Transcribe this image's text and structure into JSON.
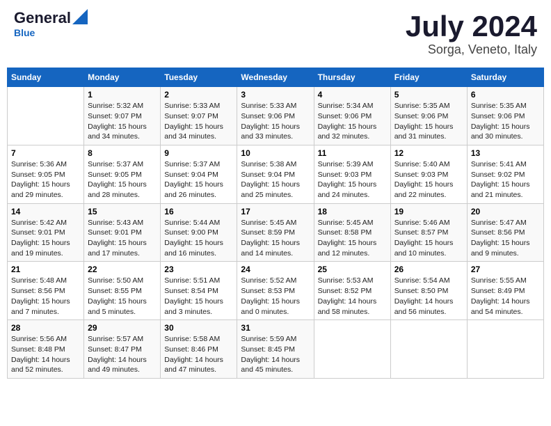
{
  "header": {
    "logo_line1": "General",
    "logo_line2": "Blue",
    "title": "July 2024",
    "subtitle": "Sorga, Veneto, Italy"
  },
  "weekdays": [
    "Sunday",
    "Monday",
    "Tuesday",
    "Wednesday",
    "Thursday",
    "Friday",
    "Saturday"
  ],
  "weeks": [
    [
      {
        "day": "",
        "info": ""
      },
      {
        "day": "1",
        "info": "Sunrise: 5:32 AM\nSunset: 9:07 PM\nDaylight: 15 hours\nand 34 minutes."
      },
      {
        "day": "2",
        "info": "Sunrise: 5:33 AM\nSunset: 9:07 PM\nDaylight: 15 hours\nand 34 minutes."
      },
      {
        "day": "3",
        "info": "Sunrise: 5:33 AM\nSunset: 9:06 PM\nDaylight: 15 hours\nand 33 minutes."
      },
      {
        "day": "4",
        "info": "Sunrise: 5:34 AM\nSunset: 9:06 PM\nDaylight: 15 hours\nand 32 minutes."
      },
      {
        "day": "5",
        "info": "Sunrise: 5:35 AM\nSunset: 9:06 PM\nDaylight: 15 hours\nand 31 minutes."
      },
      {
        "day": "6",
        "info": "Sunrise: 5:35 AM\nSunset: 9:06 PM\nDaylight: 15 hours\nand 30 minutes."
      }
    ],
    [
      {
        "day": "7",
        "info": "Sunrise: 5:36 AM\nSunset: 9:05 PM\nDaylight: 15 hours\nand 29 minutes."
      },
      {
        "day": "8",
        "info": "Sunrise: 5:37 AM\nSunset: 9:05 PM\nDaylight: 15 hours\nand 28 minutes."
      },
      {
        "day": "9",
        "info": "Sunrise: 5:37 AM\nSunset: 9:04 PM\nDaylight: 15 hours\nand 26 minutes."
      },
      {
        "day": "10",
        "info": "Sunrise: 5:38 AM\nSunset: 9:04 PM\nDaylight: 15 hours\nand 25 minutes."
      },
      {
        "day": "11",
        "info": "Sunrise: 5:39 AM\nSunset: 9:03 PM\nDaylight: 15 hours\nand 24 minutes."
      },
      {
        "day": "12",
        "info": "Sunrise: 5:40 AM\nSunset: 9:03 PM\nDaylight: 15 hours\nand 22 minutes."
      },
      {
        "day": "13",
        "info": "Sunrise: 5:41 AM\nSunset: 9:02 PM\nDaylight: 15 hours\nand 21 minutes."
      }
    ],
    [
      {
        "day": "14",
        "info": "Sunrise: 5:42 AM\nSunset: 9:01 PM\nDaylight: 15 hours\nand 19 minutes."
      },
      {
        "day": "15",
        "info": "Sunrise: 5:43 AM\nSunset: 9:01 PM\nDaylight: 15 hours\nand 17 minutes."
      },
      {
        "day": "16",
        "info": "Sunrise: 5:44 AM\nSunset: 9:00 PM\nDaylight: 15 hours\nand 16 minutes."
      },
      {
        "day": "17",
        "info": "Sunrise: 5:45 AM\nSunset: 8:59 PM\nDaylight: 15 hours\nand 14 minutes."
      },
      {
        "day": "18",
        "info": "Sunrise: 5:45 AM\nSunset: 8:58 PM\nDaylight: 15 hours\nand 12 minutes."
      },
      {
        "day": "19",
        "info": "Sunrise: 5:46 AM\nSunset: 8:57 PM\nDaylight: 15 hours\nand 10 minutes."
      },
      {
        "day": "20",
        "info": "Sunrise: 5:47 AM\nSunset: 8:56 PM\nDaylight: 15 hours\nand 9 minutes."
      }
    ],
    [
      {
        "day": "21",
        "info": "Sunrise: 5:48 AM\nSunset: 8:56 PM\nDaylight: 15 hours\nand 7 minutes."
      },
      {
        "day": "22",
        "info": "Sunrise: 5:50 AM\nSunset: 8:55 PM\nDaylight: 15 hours\nand 5 minutes."
      },
      {
        "day": "23",
        "info": "Sunrise: 5:51 AM\nSunset: 8:54 PM\nDaylight: 15 hours\nand 3 minutes."
      },
      {
        "day": "24",
        "info": "Sunrise: 5:52 AM\nSunset: 8:53 PM\nDaylight: 15 hours\nand 0 minutes."
      },
      {
        "day": "25",
        "info": "Sunrise: 5:53 AM\nSunset: 8:52 PM\nDaylight: 14 hours\nand 58 minutes."
      },
      {
        "day": "26",
        "info": "Sunrise: 5:54 AM\nSunset: 8:50 PM\nDaylight: 14 hours\nand 56 minutes."
      },
      {
        "day": "27",
        "info": "Sunrise: 5:55 AM\nSunset: 8:49 PM\nDaylight: 14 hours\nand 54 minutes."
      }
    ],
    [
      {
        "day": "28",
        "info": "Sunrise: 5:56 AM\nSunset: 8:48 PM\nDaylight: 14 hours\nand 52 minutes."
      },
      {
        "day": "29",
        "info": "Sunrise: 5:57 AM\nSunset: 8:47 PM\nDaylight: 14 hours\nand 49 minutes."
      },
      {
        "day": "30",
        "info": "Sunrise: 5:58 AM\nSunset: 8:46 PM\nDaylight: 14 hours\nand 47 minutes."
      },
      {
        "day": "31",
        "info": "Sunrise: 5:59 AM\nSunset: 8:45 PM\nDaylight: 14 hours\nand 45 minutes."
      },
      {
        "day": "",
        "info": ""
      },
      {
        "day": "",
        "info": ""
      },
      {
        "day": "",
        "info": ""
      }
    ]
  ]
}
